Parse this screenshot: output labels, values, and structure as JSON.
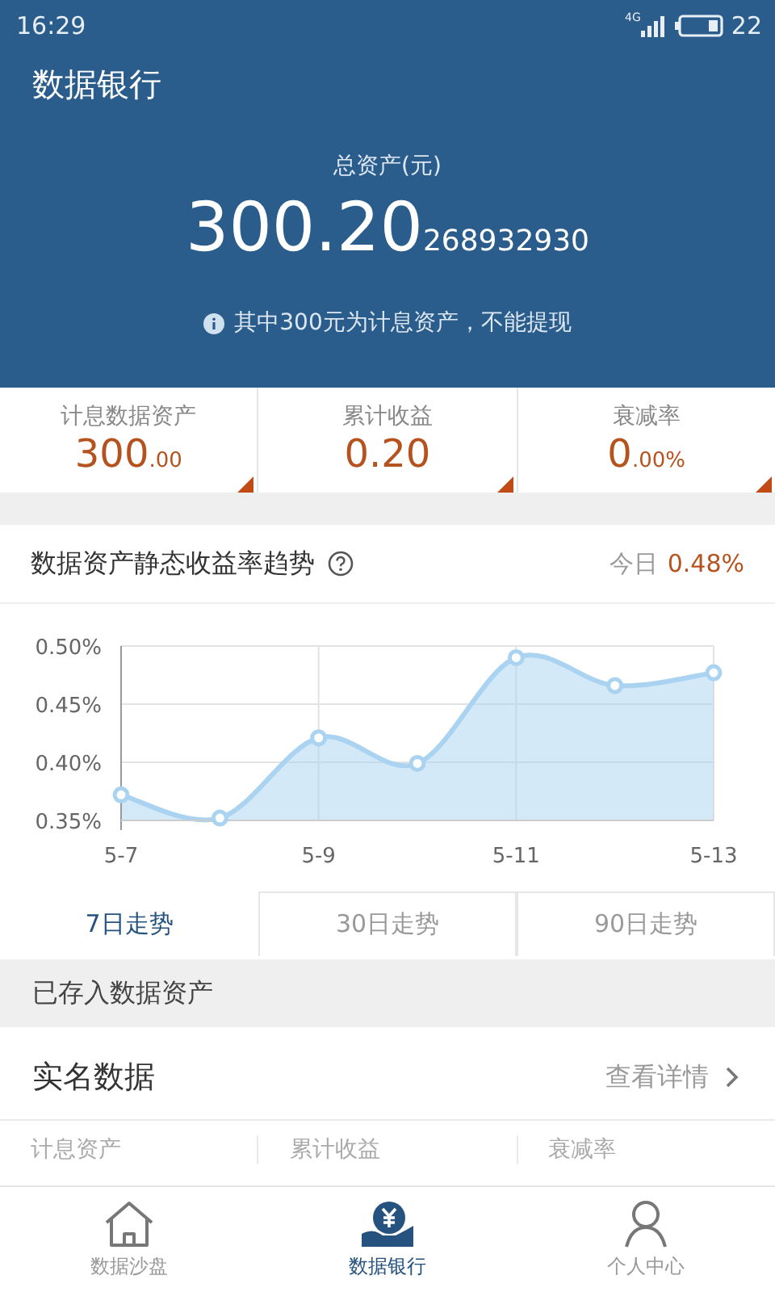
{
  "status_bar": {
    "time": "16:29",
    "network": "4G",
    "battery": "22"
  },
  "header": {
    "title": "数据银行",
    "total_label": "总资产(元)",
    "total_main": "300.20",
    "total_extra": "268932930",
    "note": "其中300元为计息资产，不能提现"
  },
  "stats": [
    {
      "label": "计息数据资产",
      "value_main": "300",
      "value_small": ".00"
    },
    {
      "label": "累计收益",
      "value_main": "0.20"
    },
    {
      "label": "衰减率",
      "value_main": "0",
      "value_small": ".00%"
    }
  ],
  "trend": {
    "title": "数据资产静态收益率趋势",
    "today_label": "今日",
    "today_value": "0.48%",
    "chart_data": {
      "type": "area",
      "categories": [
        "5-7",
        null,
        "5-9",
        null,
        "5-11",
        null,
        "5-13"
      ],
      "grid": true,
      "series": [
        {
          "color": "#a9d3f0",
          "values": [
            0.372,
            0.352,
            0.421,
            0.399,
            0.49,
            0.466,
            0.477
          ]
        }
      ],
      "ylim": [
        0.35,
        0.5
      ],
      "yticks": [
        {
          "value": 0.35,
          "label": "0.35%"
        },
        {
          "value": 0.4,
          "label": "0.40%"
        },
        {
          "value": 0.45,
          "label": "0.45%"
        },
        {
          "value": 0.5,
          "label": "0.50%"
        }
      ]
    }
  },
  "tabs": [
    {
      "label": "7日走势",
      "selected": true
    },
    {
      "label": "30日走势",
      "selected": false
    },
    {
      "label": "90日走势",
      "selected": false
    }
  ],
  "stored": {
    "title": "已存入数据资产",
    "item_title": "实名数据",
    "detail_link": "查看详情",
    "columns": [
      "计息资产",
      "累计收益",
      "衰减率"
    ]
  },
  "nav": [
    {
      "label": "数据沙盘",
      "kind": "home",
      "selected": false
    },
    {
      "label": "数据银行",
      "kind": "bank",
      "selected": true
    },
    {
      "label": "个人中心",
      "kind": "user",
      "selected": false
    }
  ]
}
